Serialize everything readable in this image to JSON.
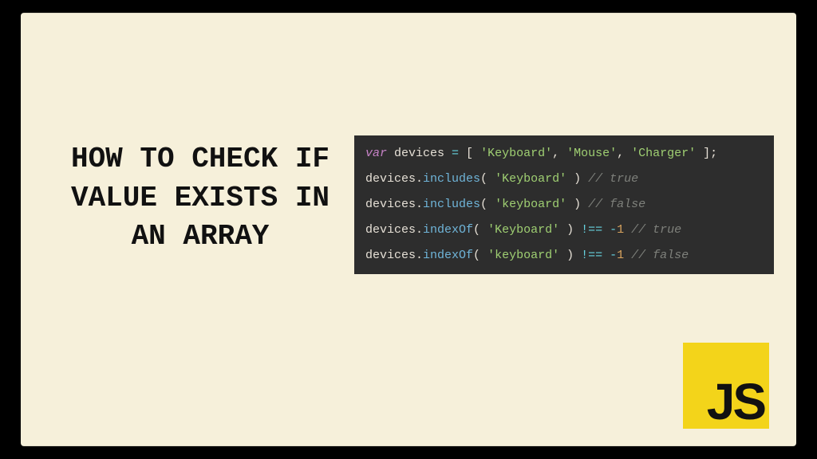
{
  "title": "HOW TO CHECK IF VALUE EXISTS IN AN ARRAY",
  "code": {
    "l1_kw": "var",
    "l1_a": " devices ",
    "l1_eq": "=",
    "l1_b": " [ ",
    "l1_s1": "'Keyboard'",
    "l1_c1": ", ",
    "l1_s2": "'Mouse'",
    "l1_c2": ", ",
    "l1_s3": "'Charger'",
    "l1_d": " ];",
    "l2_obj": "devices",
    "l2_dot": ".",
    "l2_m": "includes",
    "l2_p1": "( ",
    "l2_s": "'Keyboard'",
    "l2_p2": " ) ",
    "l2_cmt": "// true",
    "l3_obj": "devices",
    "l3_dot": ".",
    "l3_m": "includes",
    "l3_p1": "( ",
    "l3_s": "'keyboard'",
    "l3_p2": " ) ",
    "l3_cmt": "// false",
    "l4_obj": "devices",
    "l4_dot": ".",
    "l4_m": "indexOf",
    "l4_p1": "( ",
    "l4_s": "'Keyboard'",
    "l4_p2": " ) ",
    "l4_op": "!==",
    "l4_sp": " ",
    "l4_neg": "-",
    "l4_n": "1",
    "l4_sp2": " ",
    "l4_cmt": "// true",
    "l5_obj": "devices",
    "l5_dot": ".",
    "l5_m": "indexOf",
    "l5_p1": "( ",
    "l5_s": "'keyboard'",
    "l5_p2": " ) ",
    "l5_op": "!==",
    "l5_sp": " ",
    "l5_neg": "-",
    "l5_n": "1",
    "l5_sp2": " ",
    "l5_cmt": "// false"
  },
  "logo": "JS"
}
